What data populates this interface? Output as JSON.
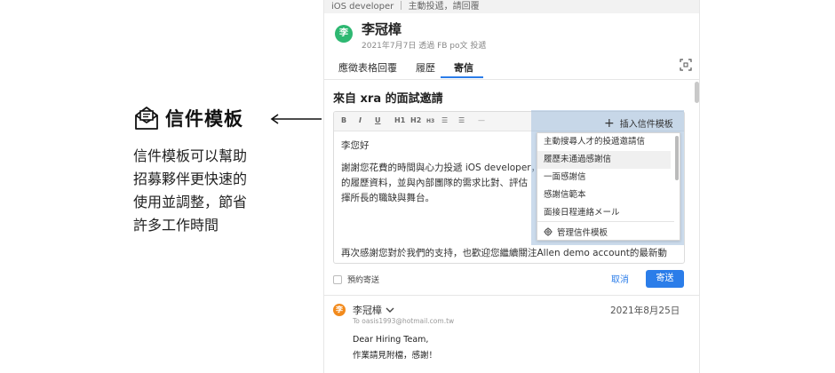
{
  "promo": {
    "title": "信件模板",
    "icon": "envelope-letter-icon",
    "description": [
      "信件模板可以幫助",
      "招募夥伴更快速的",
      "使用並調整，節省",
      "許多工作時間"
    ]
  },
  "breadcrumb": "iOS developer ｜ 主動投遞，請回覆",
  "candidate": {
    "avatar_initial": "李",
    "name": "李冠樟",
    "subtitle": "2021年7月7日 透過 FB po文 投遞"
  },
  "tabs": [
    {
      "label": "應徵表格回覆"
    },
    {
      "label": "履歷"
    },
    {
      "label": "寄信"
    }
  ],
  "active_tab": "寄信",
  "mail": {
    "title": "來自 xra 的面試邀請",
    "toolbar": [
      "B",
      "I",
      "U",
      "H1",
      "H2",
      "H3",
      "☰",
      "☰",
      "—"
    ],
    "greeting": "李您好",
    "body_lines": [
      "謝謝您花費的時間與心力投遞 iOS developer，",
      "的履歷資料，並與內部團隊的需求比對、評估",
      "揮所長的職缺與舞台。"
    ],
    "closing": "再次感謝您對於我們的支持，也歡迎您繼續關注Allen demo account的最新動"
  },
  "templates": {
    "insert_label": "插入信件模板",
    "items": [
      "主動搜尋人才的投遞邀請信",
      "履歷未通過感謝信",
      "一面感謝信",
      "感謝信範本",
      "面接日程連絡メール"
    ],
    "manage_label": "管理信件模板"
  },
  "actions": {
    "schedule_label": "預約寄送",
    "cancel_label": "取消",
    "send_label": "寄送"
  },
  "reply": {
    "avatar_initial": "李",
    "name": "李冠樟",
    "to": "To oasis1993@hotmail.com.tw",
    "date": "2021年8月25日",
    "body": [
      "Dear Hiring Team,",
      "作業請見附檔，感謝！"
    ]
  },
  "colors": {
    "accent": "#2b7de9",
    "avatar_green": "#2eb872",
    "avatar_orange": "#f28a1c",
    "highlight_overlay": "#a0bedc"
  }
}
